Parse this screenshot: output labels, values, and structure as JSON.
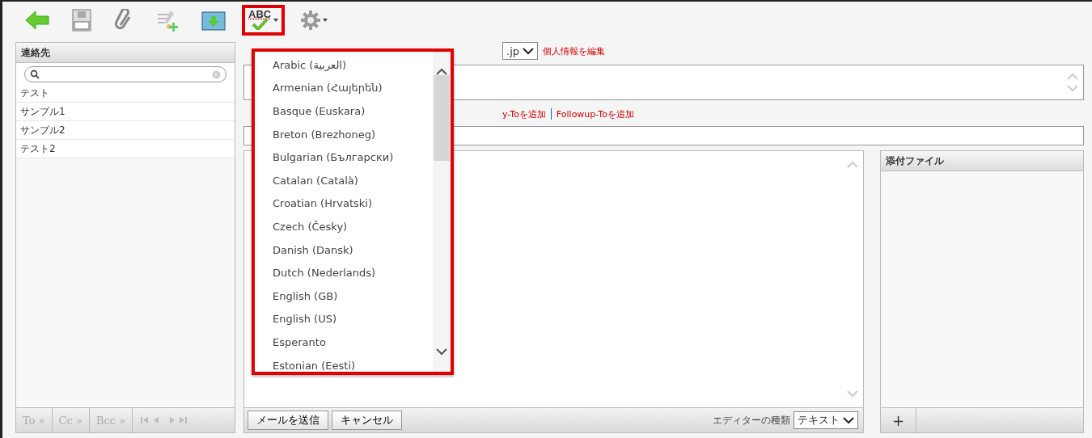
{
  "toolbar": {
    "buttons": [
      {
        "kind": "back",
        "caret": false,
        "highlighted": false
      },
      {
        "kind": "save",
        "caret": false,
        "highlighted": false
      },
      {
        "kind": "attach",
        "caret": false,
        "highlighted": false
      },
      {
        "kind": "signature",
        "caret": false,
        "highlighted": false
      },
      {
        "kind": "import",
        "caret": false,
        "highlighted": false
      },
      {
        "kind": "spellcheck",
        "label": "ABC",
        "caret": true,
        "highlighted": true
      },
      {
        "kind": "settings",
        "caret": true,
        "highlighted": false
      }
    ]
  },
  "contacts": {
    "title": "連絡先",
    "items": [
      "テスト",
      "サンプル1",
      "サンプル2",
      "テスト2"
    ],
    "buttons": [
      {
        "label": "To »",
        "disabled": true
      },
      {
        "label": "Cc »",
        "disabled": true
      },
      {
        "label": "Bcc »",
        "disabled": true
      }
    ]
  },
  "form": {
    "from_value": ".jp",
    "edit_profile_link": "個人情報を編集",
    "add_links": [
      "y-Toを追加",
      "Followup-Toを追加"
    ]
  },
  "attachments": {
    "title": "添付ファイル",
    "add_button": "+"
  },
  "footer": {
    "send_button": "メールを送信",
    "cancel_button": "キャンセル",
    "editor_label": "エディターの種類",
    "editor_value": "テキスト"
  },
  "language_menu": {
    "highlighted": true,
    "items": [
      "Arabic (العربية)",
      "Armenian (Հայերեն)",
      "Basque (Euskara)",
      "Breton (Brezhoneg)",
      "Bulgarian (Български)",
      "Catalan (Català)",
      "Croatian (Hrvatski)",
      "Czech (Česky)",
      "Danish (Dansk)",
      "Dutch (Nederlands)",
      "English (GB)",
      "English (US)",
      "Esperanto",
      "Estonian (Eesti)"
    ]
  }
}
